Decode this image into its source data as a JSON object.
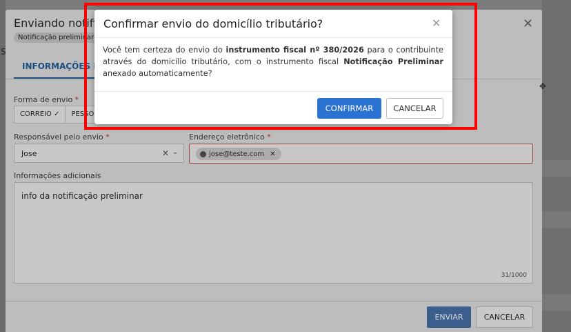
{
  "background": {
    "fragment_letter": "S"
  },
  "modal": {
    "title": "Enviando notific",
    "badge": "Notificação preliminar",
    "close_glyph": "✕",
    "tab": "INFORMAÇÕES DO",
    "tools_glyph": "✥",
    "form": {
      "forma_label": "Forma de envio",
      "required_mark": "*",
      "options": [
        "CORREIO ✓",
        "PESSO"
      ],
      "responsavel_label": "Responsável pelo envio",
      "responsavel_value": "Jose",
      "clear_glyph": "✕",
      "chevron_glyph": "⌄",
      "email_label": "Endereço eletrônico",
      "email_chip": "jose@teste.com",
      "chip_remove": "✕",
      "info_label": "Informações adicionais",
      "info_value": "info da  notificação preliminar",
      "info_counter": "31/1000"
    },
    "footer": {
      "send_label": "ENVIAR",
      "cancel_label": "CANCELAR"
    }
  },
  "confirm": {
    "title": "Confirmar envio do domicílio tributário?",
    "close_glyph": "✕",
    "body_pre": "Você tem certeza do envio do ",
    "body_bold1": "instrumento fiscal nº 380/2026",
    "body_mid": " para o contribuinte através do domicílio tributário, com o instrumento fiscal ",
    "body_bold2": "Notificação Preliminar",
    "body_post": " anexado automaticamente?",
    "confirm_label": "CONFIRMAR",
    "cancel_label": "CANCELAR"
  },
  "colors": {
    "highlight": "#ff0000",
    "primary": "#2a73d2"
  }
}
